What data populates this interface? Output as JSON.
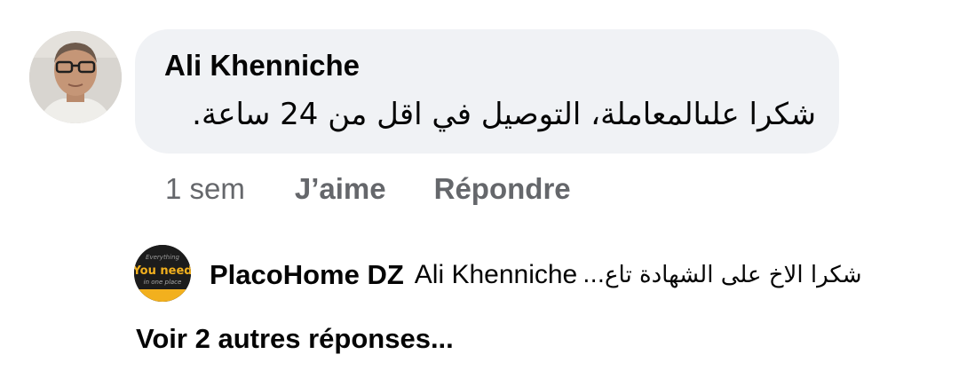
{
  "comment": {
    "author": "Ali Khenniche",
    "text": "شكرا علىالمعاملة، التوصيل في اقل من 24 ساعة.",
    "timestamp": "1 sem",
    "like_label": "J’aime",
    "reply_label": "Répondre",
    "avatar_icon": "user-photo-avatar"
  },
  "reply": {
    "author": "PlacoHome DZ",
    "mention": "Ali Khenniche",
    "snippet": "شكرا الاخ على الشهادة تاع...",
    "avatar_icon": "brand-logo-avatar",
    "logo_text_top": "Everything",
    "logo_text_main": "You need",
    "logo_text_bottom": "in one place"
  },
  "more_replies_label": "Voir 2 autres réponses...",
  "colors": {
    "bubble_bg": "#f0f2f5",
    "secondary_text": "#65676b",
    "primary_text": "#050505",
    "logo_accent": "#f2b01e"
  }
}
